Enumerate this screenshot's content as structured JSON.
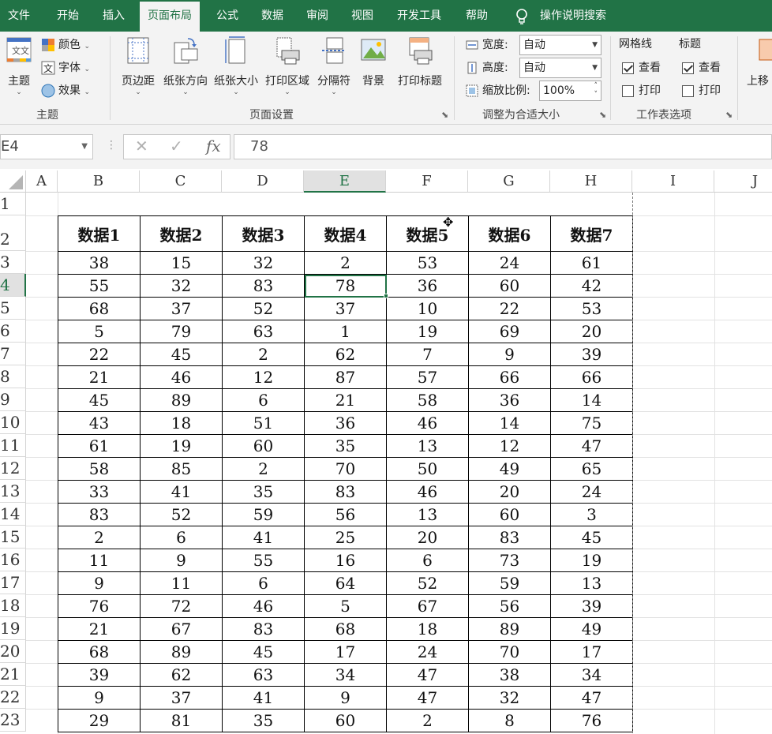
{
  "tabs": [
    {
      "label": "文件",
      "active": false
    },
    {
      "label": "开始",
      "active": false
    },
    {
      "label": "插入",
      "active": false
    },
    {
      "label": "页面布局",
      "active": true
    },
    {
      "label": "公式",
      "active": false
    },
    {
      "label": "数据",
      "active": false
    },
    {
      "label": "审阅",
      "active": false
    },
    {
      "label": "视图",
      "active": false
    },
    {
      "label": "开发工具",
      "active": false
    },
    {
      "label": "帮助",
      "active": false
    }
  ],
  "tell_me": "操作说明搜索",
  "ribbon": {
    "theme_group": {
      "label": "主题",
      "theme_button": "主题",
      "colors": "颜色",
      "fonts": "字体",
      "effects": "效果"
    },
    "page_setup_group": {
      "label": "页面设置",
      "margins": "页边距",
      "orientation": "纸张方向",
      "size": "纸张大小",
      "print_area": "打印区域",
      "breaks": "分隔符",
      "background": "背景",
      "print_titles": "打印标题"
    },
    "scale_group": {
      "label": "调整为合适大小",
      "width_label": "宽度:",
      "width_value": "自动",
      "height_label": "高度:",
      "height_value": "自动",
      "scale_label": "缩放比例:",
      "scale_value": "100%"
    },
    "sheet_options_group": {
      "label": "工作表选项",
      "gridlines": "网格线",
      "headings": "标题",
      "view": "查看",
      "print": "打印"
    },
    "arrange_partial": "上移"
  },
  "formula_bar": {
    "name_box": "E4",
    "fx": "fx",
    "value": "78"
  },
  "colors": {
    "accent": "#217346",
    "header_selected_bg": "#e1e1e1"
  },
  "columns": [
    "A",
    "B",
    "C",
    "D",
    "E",
    "F",
    "G",
    "H",
    "I",
    "J"
  ],
  "rows": [
    "1",
    "2",
    "3",
    "4",
    "5",
    "6",
    "7",
    "8",
    "9",
    "10",
    "11",
    "12",
    "13",
    "14",
    "15",
    "16",
    "17",
    "18",
    "19",
    "20",
    "21",
    "22",
    "23"
  ],
  "selected_cell": {
    "col": "E",
    "row": "4"
  },
  "table": {
    "headers": [
      "数据1",
      "数据2",
      "数据3",
      "数据4",
      "数据5",
      "数据6",
      "数据7"
    ],
    "rows": [
      [
        "38",
        "15",
        "32",
        "2",
        "53",
        "24",
        "61"
      ],
      [
        "55",
        "32",
        "83",
        "78",
        "36",
        "60",
        "42"
      ],
      [
        "68",
        "37",
        "52",
        "37",
        "10",
        "22",
        "53"
      ],
      [
        "5",
        "79",
        "63",
        "1",
        "19",
        "69",
        "20"
      ],
      [
        "22",
        "45",
        "2",
        "62",
        "7",
        "9",
        "39"
      ],
      [
        "21",
        "46",
        "12",
        "87",
        "57",
        "66",
        "66"
      ],
      [
        "45",
        "89",
        "6",
        "21",
        "58",
        "36",
        "14"
      ],
      [
        "43",
        "18",
        "51",
        "36",
        "46",
        "14",
        "75"
      ],
      [
        "61",
        "19",
        "60",
        "35",
        "13",
        "12",
        "47"
      ],
      [
        "58",
        "85",
        "2",
        "70",
        "50",
        "49",
        "65"
      ],
      [
        "33",
        "41",
        "35",
        "83",
        "46",
        "20",
        "24"
      ],
      [
        "83",
        "52",
        "59",
        "56",
        "13",
        "60",
        "3"
      ],
      [
        "2",
        "6",
        "41",
        "25",
        "20",
        "83",
        "45"
      ],
      [
        "11",
        "9",
        "55",
        "16",
        "6",
        "73",
        "19"
      ],
      [
        "9",
        "11",
        "6",
        "64",
        "52",
        "59",
        "13"
      ],
      [
        "76",
        "72",
        "46",
        "5",
        "67",
        "56",
        "39"
      ],
      [
        "21",
        "67",
        "83",
        "68",
        "18",
        "89",
        "49"
      ],
      [
        "68",
        "89",
        "45",
        "17",
        "24",
        "70",
        "17"
      ],
      [
        "39",
        "62",
        "63",
        "34",
        "47",
        "38",
        "34"
      ],
      [
        "9",
        "37",
        "41",
        "9",
        "47",
        "32",
        "47"
      ],
      [
        "29",
        "81",
        "35",
        "60",
        "2",
        "8",
        "76"
      ]
    ]
  }
}
